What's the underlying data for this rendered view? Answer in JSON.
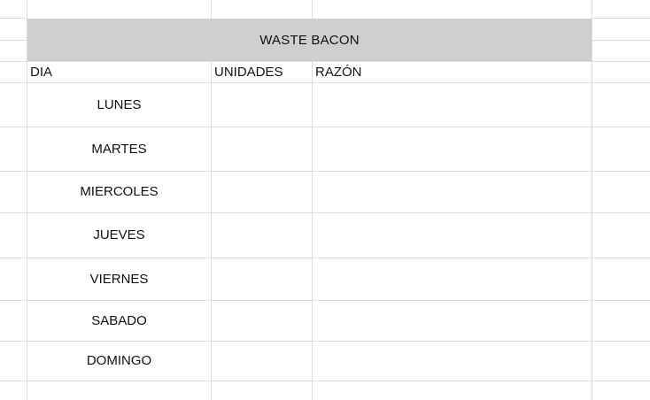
{
  "sheet": {
    "title": "WASTE BACON",
    "columns": [
      "DIA",
      "UNIDADES",
      "RAZÓN"
    ],
    "rows": [
      {
        "dia": "LUNES",
        "unidades": "",
        "razon": ""
      },
      {
        "dia": "MARTES",
        "unidades": "",
        "razon": ""
      },
      {
        "dia": "MIERCOLES",
        "unidades": "",
        "razon": ""
      },
      {
        "dia": "JUEVES",
        "unidades": "",
        "razon": ""
      },
      {
        "dia": "VIERNES",
        "unidades": "",
        "razon": ""
      },
      {
        "dia": "SABADO",
        "unidades": "",
        "razon": ""
      },
      {
        "dia": "DOMINGO",
        "unidades": "",
        "razon": ""
      }
    ]
  },
  "colors": {
    "title_fill": "#d0cece",
    "gridline": "#dadcdf"
  }
}
